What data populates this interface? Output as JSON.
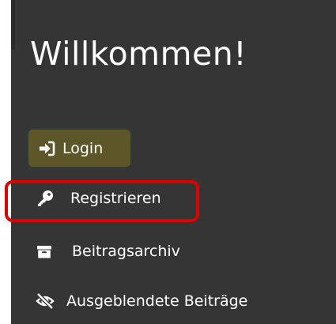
{
  "sidebar": {
    "title": "Willkommen!",
    "items": [
      {
        "label": "Login",
        "icon": "sign-in-icon",
        "state": "active"
      },
      {
        "label": "Registrieren",
        "icon": "key-icon",
        "highlighted": true
      },
      {
        "label": "Beitragsarchiv",
        "icon": "archive-box-icon"
      },
      {
        "label": "Ausgeblendete Beiträge",
        "icon": "eye-slash-icon"
      }
    ]
  },
  "colors": {
    "background": "#353535",
    "login_button_bg": "#5d5628",
    "highlight": "#e00000",
    "text": "#ffffff"
  }
}
